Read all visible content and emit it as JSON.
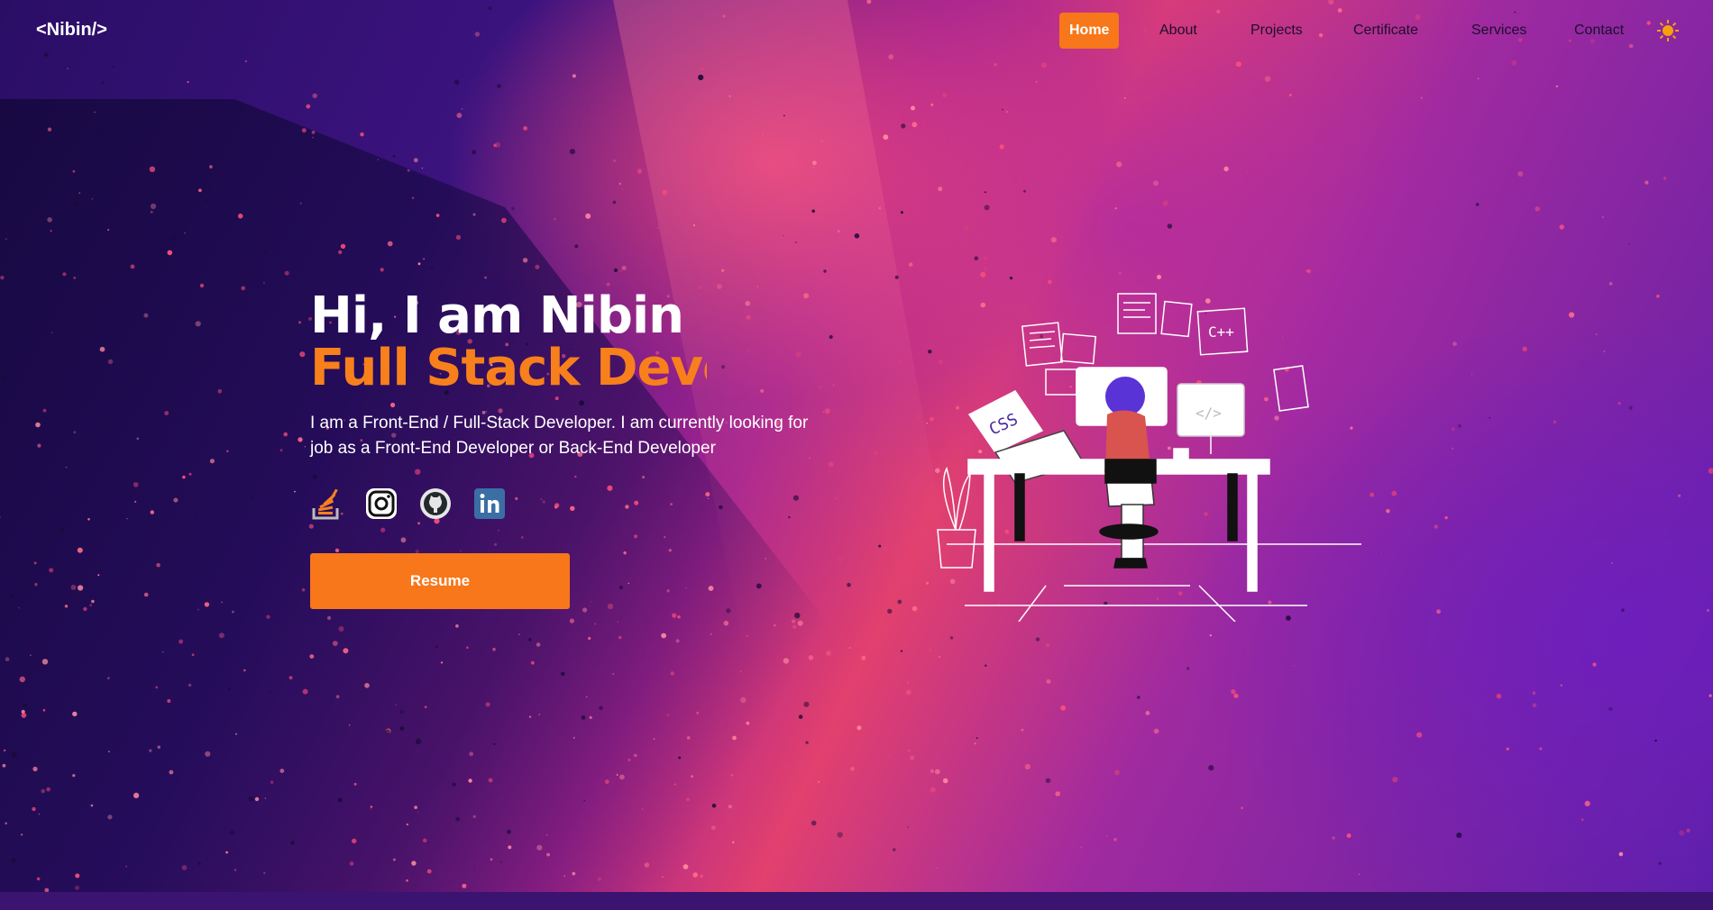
{
  "brand": {
    "logo_text": "<Nibin/>"
  },
  "nav": {
    "items": [
      {
        "label": "Home",
        "active": true
      },
      {
        "label": "About"
      },
      {
        "label": "Projects"
      },
      {
        "label": "Certificate"
      },
      {
        "label": "Services"
      },
      {
        "label": "Contact"
      }
    ],
    "theme_icon": "sun-icon"
  },
  "hero": {
    "greeting": "Hi, I am Nibin",
    "role_typed": "Full Stack Devel",
    "description": "I am a Front-End / Full-Stack Developer. I am currently looking for job as a Front-End Developer or Back-End Developer",
    "socials": [
      {
        "icon": "stackoverflow-icon"
      },
      {
        "icon": "instagram-icon"
      },
      {
        "icon": "github-icon"
      },
      {
        "icon": "linkedin-icon"
      }
    ],
    "resume_label": "Resume"
  },
  "illustration": {
    "laptop_label": "CSS",
    "sticky_label": "C++",
    "monitor_label": "</>"
  },
  "colors": {
    "accent": "#f7771a",
    "text_light": "#ffffff",
    "nav_text": "#1a0f2b"
  }
}
